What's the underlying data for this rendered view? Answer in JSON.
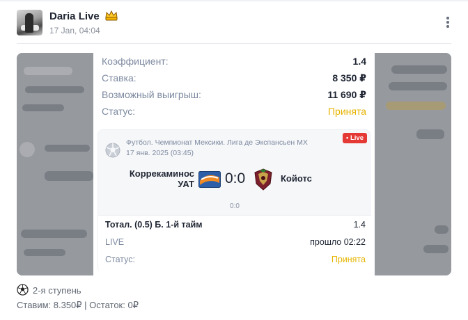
{
  "post": {
    "author": "Daria Live",
    "date": "17 Jan, 04:04"
  },
  "ticket": {
    "rows": [
      {
        "label": "Коэффициент:",
        "value": "1.4"
      },
      {
        "label": "Ставка:",
        "value": "8 350 ₽"
      },
      {
        "label": "Возможный выигрыш:",
        "value": "11 690 ₽"
      },
      {
        "label": "Статус:",
        "value": "Принята"
      }
    ],
    "event": {
      "league": "Футбол. Чемпионат Мексики. Лига де Экспансьен МХ",
      "date": "17 янв. 2025 (03:45)",
      "live_badge": "• Live",
      "home_team": "Коррекаминос УАТ",
      "away_team": "Койотс",
      "score": "0:0",
      "half_score": "0:0"
    },
    "bet": {
      "market": "Тотал. (0.5) Б. 1-й тайм",
      "odds": "1.4",
      "state_label": "LIVE",
      "state_value": "прошло 02:22",
      "status_label": "Статус:",
      "status_value": "Принята"
    }
  },
  "footer": {
    "stage": "2-я ступень",
    "summary": "Ставим: 8.350₽ | Остаток: 0₽"
  },
  "colors": {
    "accent": "#e6b400",
    "live": "#e53935",
    "muted": "#7d8aa0"
  },
  "icons": [
    "crown-icon",
    "more-vertical-icon",
    "football-icon",
    "soccer-ball-icon",
    "team-logo-home",
    "team-logo-away"
  ]
}
